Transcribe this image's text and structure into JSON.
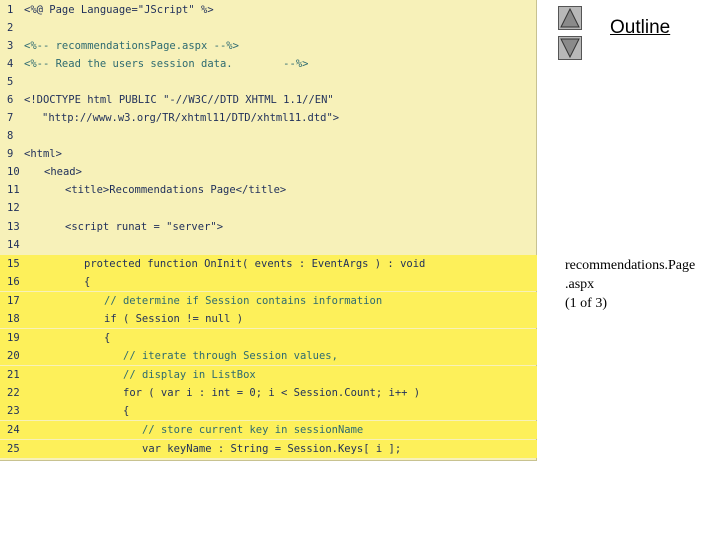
{
  "outline": {
    "title": "Outline",
    "prev_button": "up-triangle",
    "next_button": "down-triangle"
  },
  "caption": {
    "line1": "recommendations.Page",
    "line2": ".aspx",
    "line3": "(1 of 3)"
  },
  "code": {
    "lines": [
      {
        "n": "1",
        "text": "<%@ Page Language=\"JScript\" %>"
      },
      {
        "n": "2",
        "text": ""
      },
      {
        "n": "3",
        "text": "<%-- recommendationsPage.aspx --%>"
      },
      {
        "n": "4",
        "text": "<%-- Read the users session data.        --%>"
      },
      {
        "n": "5",
        "text": ""
      },
      {
        "n": "6",
        "text": "<!DOCTYPE html PUBLIC \"-//W3C//DTD XHTML 1.1//EN\""
      },
      {
        "n": "7",
        "text": "\"http://www.w3.org/TR/xhtml11/DTD/xhtml11.dtd\">"
      },
      {
        "n": "8",
        "text": ""
      },
      {
        "n": "9",
        "text": "<html>"
      },
      {
        "n": "10",
        "text": "<head>"
      },
      {
        "n": "11",
        "text": "<title>Recommendations Page</title>"
      },
      {
        "n": "12",
        "text": ""
      },
      {
        "n": "13",
        "text": "<script runat = \"server\">"
      },
      {
        "n": "14",
        "text": ""
      },
      {
        "n": "15",
        "text": "protected function OnInit( events : EventArgs ) : void"
      },
      {
        "n": "16",
        "text": "{"
      },
      {
        "n": "17",
        "text": "// determine if Session contains information"
      },
      {
        "n": "18",
        "text": "if ( Session != null )"
      },
      {
        "n": "19",
        "text": "{"
      },
      {
        "n": "20",
        "text": "// iterate through Session values,"
      },
      {
        "n": "21",
        "text": "// display in ListBox"
      },
      {
        "n": "22",
        "text": "for ( var i : int = 0; i < Session.Count; i++ )"
      },
      {
        "n": "23",
        "text": "{"
      },
      {
        "n": "24",
        "text": "// store current key in sessionName"
      },
      {
        "n": "25",
        "text": "var keyName : String = Session.Keys[ i ];"
      }
    ]
  }
}
